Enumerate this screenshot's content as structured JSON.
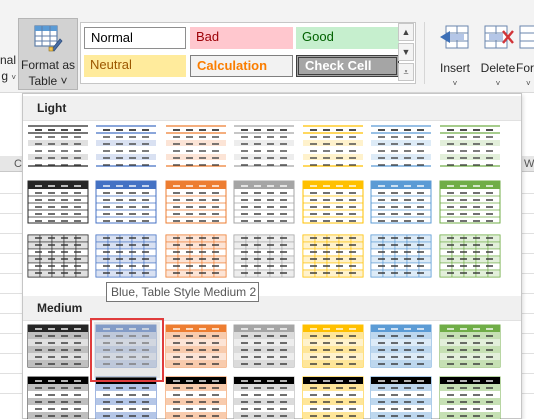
{
  "ribbon": {
    "conditional_fragment": "nal\ng ˅",
    "format_as_table": {
      "line1": "Format as",
      "line2": "Table ˅"
    },
    "cell_styles": {
      "normal": "Normal",
      "bad": "Bad",
      "good": "Good",
      "neutral": "Neutral",
      "calculation": "Calculation",
      "check_cell": "Check Cell"
    },
    "insert": {
      "label": "Insert",
      "caret": "˅"
    },
    "delete": {
      "label": "Delete",
      "caret": "˅"
    },
    "format_fragment": {
      "label": "For",
      "caret": "˅"
    }
  },
  "sheet": {
    "left_col_letter": "C",
    "right_col_letter": "W"
  },
  "gallery": {
    "sections": {
      "light": "Light",
      "medium": "Medium"
    },
    "hovered_index": 1,
    "tooltip": "Blue, Table Style Medium 2",
    "light_colors": [
      "#262626",
      "#4472c4",
      "#ed7d31",
      "#a5a5a5",
      "#ffc000",
      "#5b9bd5",
      "#70ad47"
    ],
    "medium_tints": [
      "#bfbfbf",
      "#b4c6e7",
      "#f8cbad",
      "#dbdbdb",
      "#ffe699",
      "#bdd7ee",
      "#c6e0b4"
    ],
    "medium_light_tints": [
      "#e0e0e0",
      "#d9e1f2",
      "#fce4d6",
      "#ededed",
      "#fff2cc",
      "#ddebf7",
      "#e2efda"
    ]
  }
}
